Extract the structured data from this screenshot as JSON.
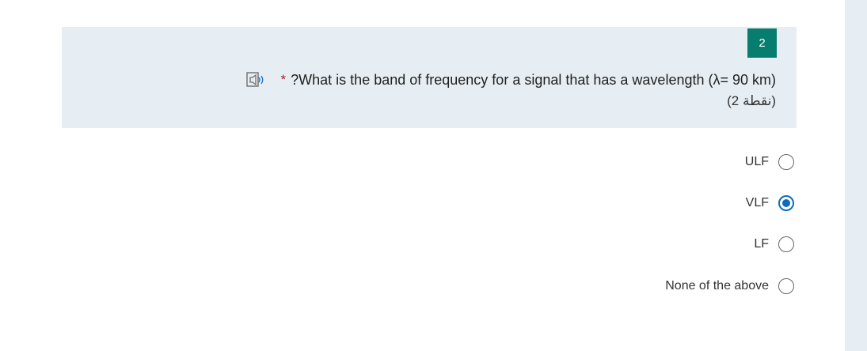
{
  "question": {
    "number": "2",
    "required_marker": "*",
    "title": "?What is the band of frequency for a signal that has a wavelength (λ= 90 km)",
    "points": "(2 نقطة)",
    "speaker_icon": "immersive-reader-icon"
  },
  "options": [
    {
      "label": "ULF",
      "selected": false
    },
    {
      "label": "VLF",
      "selected": true
    },
    {
      "label": "LF",
      "selected": false
    },
    {
      "label": "None of the above",
      "selected": false
    }
  ],
  "colors": {
    "accent": "#0f6cbd",
    "number_badge": "#077d6f",
    "question_bg": "#e7eef3",
    "required": "#a4262c"
  }
}
